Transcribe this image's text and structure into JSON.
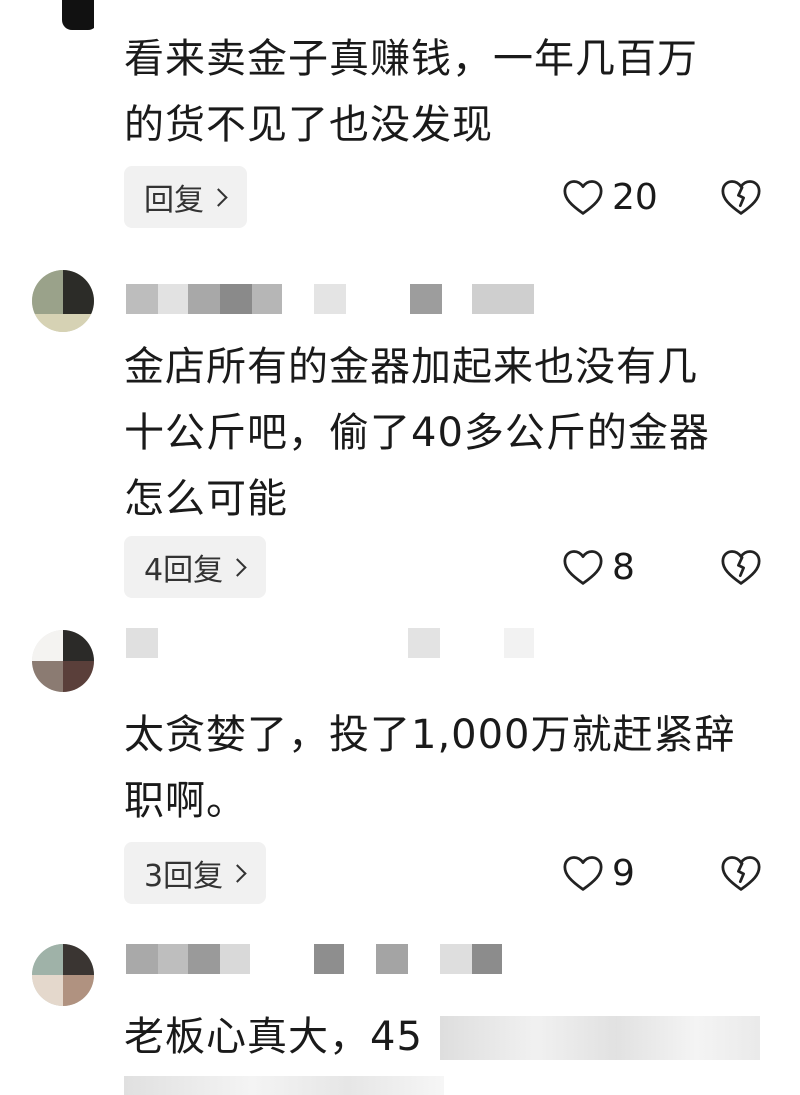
{
  "comments": [
    {
      "text": "看来卖金子真赚钱，一年几百万\n的货不见了也没发现",
      "reply_label": "回复",
      "likes": "20"
    },
    {
      "text": "金店所有的金器加起来也没有几\n十公斤吧，偷了40多公斤的金器\n怎么可能",
      "reply_label": "4回复",
      "likes": "8"
    },
    {
      "text": "太贪婪了，投了1,000万就赶紧辞\n职啊。",
      "reply_label": "3回复",
      "likes": "9"
    },
    {
      "text": "老板心真大，45",
      "reply_label": "",
      "likes": ""
    }
  ],
  "icons": {
    "like": "heart-outline-icon",
    "dislike": "broken-heart-icon",
    "reply": "chevron-right-icon"
  },
  "colors": {
    "text": "#1a1a1a",
    "reply_bg": "#f1f1f1",
    "icon": "#222222"
  }
}
